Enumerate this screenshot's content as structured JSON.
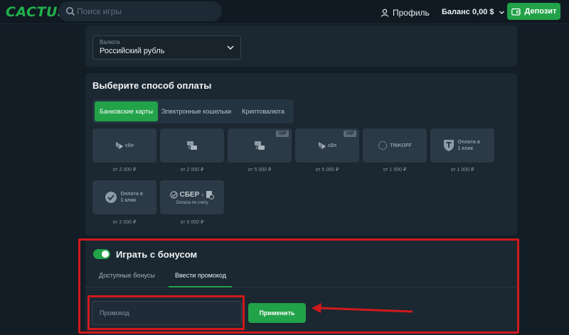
{
  "header": {
    "logo": "CACTUS",
    "search_placeholder": "Поиск игры",
    "profile_label": "Профиль",
    "balance_label": "Баланс 0,00 $",
    "deposit_label": "Депозит"
  },
  "currency": {
    "label": "Валюта",
    "value": "Российский рубль"
  },
  "payment": {
    "title": "Выберите способ оплаты",
    "tabs": [
      "Банковские карты",
      "Электронные кошельки",
      "Криптовалюта"
    ],
    "methods": [
      {
        "logo": "сбп",
        "vip": "",
        "min": "от 2 000 ₽"
      },
      {
        "logo": "",
        "vip": "",
        "min": "от 2 000 ₽"
      },
      {
        "logo": "",
        "vip": "VIP",
        "min": "от 5 000 ₽"
      },
      {
        "logo": "сбп",
        "vip": "VIP",
        "min": "от 5 000 ₽"
      },
      {
        "logo": "TINKOFF",
        "vip": "",
        "min": "от 1 000 ₽"
      },
      {
        "logo": "Оплата в 1 клик",
        "vip": "",
        "min": "от 1 000 ₽"
      },
      {
        "logo": "Оплата в 1 клик",
        "vip": "",
        "min": "от 2 000 ₽"
      },
      {
        "logo": "СБЕР",
        "sublogo": "Оплата по счету",
        "vip": "",
        "min": "от 5 000 ₽"
      }
    ]
  },
  "bonus": {
    "title": "Играть с бонусом",
    "toggle_on": true,
    "tabs": [
      "Доступные бонусы",
      "Ввести промокод"
    ],
    "active_tab": 1,
    "promo_placeholder": "Промокод",
    "apply_label": "Применить"
  },
  "colors": {
    "accent": "#22a249",
    "background": "#131d26",
    "panel": "#1b2731",
    "highlight": "#d0191c"
  }
}
